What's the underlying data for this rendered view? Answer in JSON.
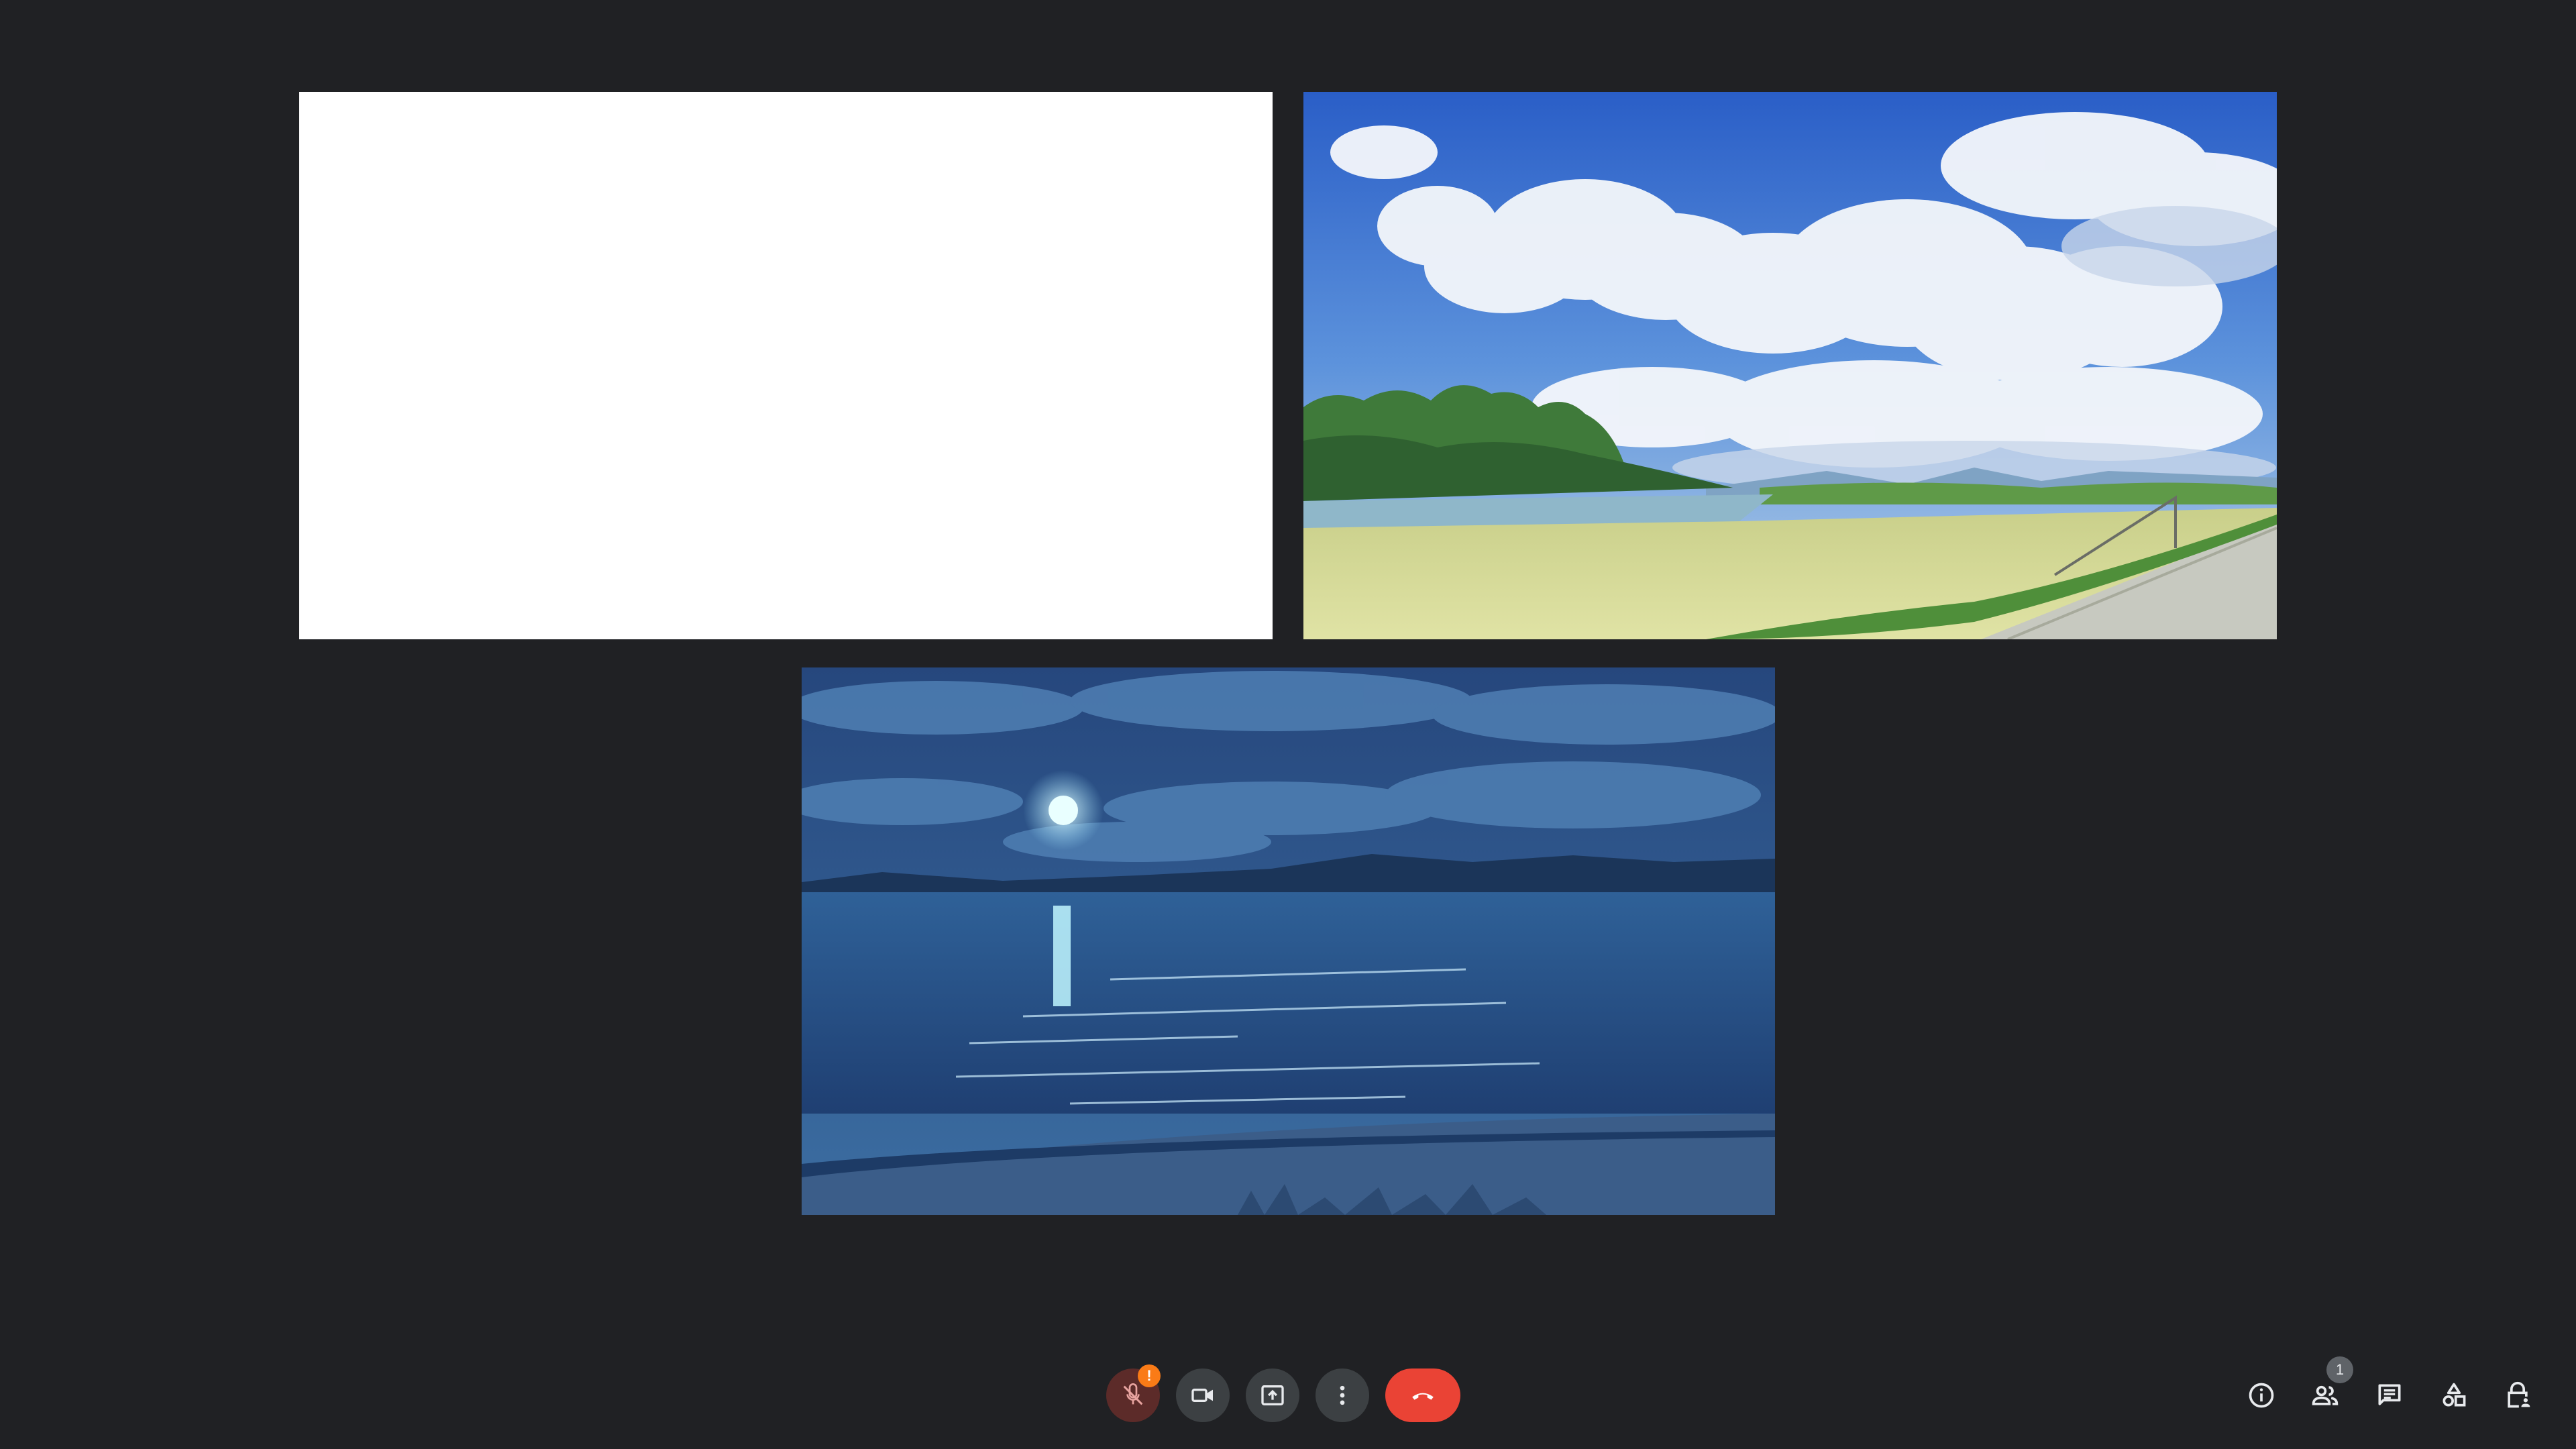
{
  "participants": {
    "count_badge": "1"
  },
  "mic": {
    "warning_badge": "!"
  },
  "tiles": [
    {
      "scene": "blank-white"
    },
    {
      "scene": "daytime-field-with-clouds"
    },
    {
      "scene": "moonlit-lake-at-night"
    }
  ],
  "icons": {
    "mic": "mic-off-icon",
    "camera": "videocam-icon",
    "present": "present-to-all-icon",
    "more": "more-vert-icon",
    "leave": "call-end-icon",
    "info": "info-icon",
    "people": "people-icon",
    "chat": "chat-icon",
    "activities": "activities-icon",
    "host": "lock-person-icon"
  },
  "colors": {
    "background": "#202124",
    "button": "#3c4043",
    "leave": "#ea4335",
    "mic_muted": "#5c2b29",
    "warning": "#fa7b17",
    "icon": "#e8eaed"
  }
}
